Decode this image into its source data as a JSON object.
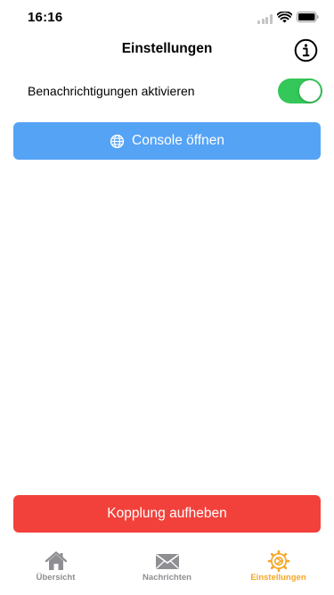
{
  "status_bar": {
    "time": "16:16"
  },
  "nav": {
    "title": "Einstellungen",
    "info_icon": "info-circle-icon"
  },
  "settings": {
    "notifications_label": "Benachrichtigungen aktivieren",
    "notifications_enabled": true
  },
  "console_button": {
    "label": "Console öffnen",
    "icon": "globe-icon"
  },
  "unpair_button": {
    "label": "Kopplung aufheben"
  },
  "tabs": [
    {
      "label": "Übersicht",
      "icon": "home-icon",
      "active": false
    },
    {
      "label": "Nachrichten",
      "icon": "envelope-icon",
      "active": false
    },
    {
      "label": "Einstellungen",
      "icon": "gear-icon",
      "active": true
    }
  ],
  "colors": {
    "toggle_on": "#34c759",
    "console_button": "#55a3f5",
    "unpair_button": "#f2413b",
    "tab_active": "#f5a623",
    "tab_inactive": "#8e8e93"
  }
}
